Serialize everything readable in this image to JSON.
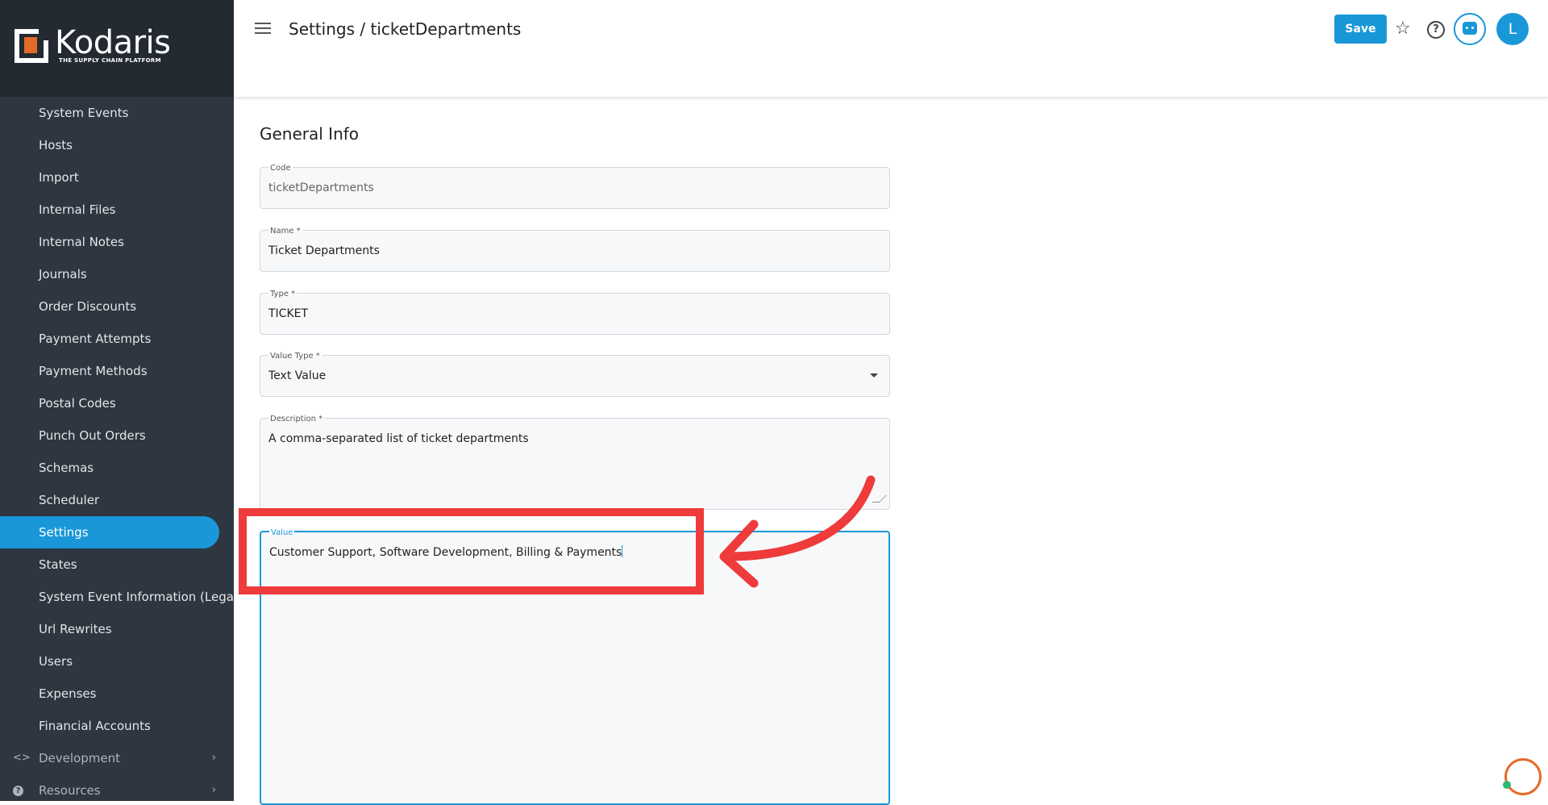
{
  "brand": {
    "name": "Kodaris",
    "tagline": "THE SUPPLY CHAIN PLATFORM"
  },
  "sidebar": {
    "items": [
      {
        "label": "System Events"
      },
      {
        "label": "Hosts"
      },
      {
        "label": "Import"
      },
      {
        "label": "Internal Files"
      },
      {
        "label": "Internal Notes"
      },
      {
        "label": "Journals"
      },
      {
        "label": "Order Discounts"
      },
      {
        "label": "Payment Attempts"
      },
      {
        "label": "Payment Methods"
      },
      {
        "label": "Postal Codes"
      },
      {
        "label": "Punch Out Orders"
      },
      {
        "label": "Schemas"
      },
      {
        "label": "Scheduler"
      },
      {
        "label": "Settings",
        "active": true
      },
      {
        "label": "States"
      },
      {
        "label": "System Event Information (Legacy)"
      },
      {
        "label": "Url Rewrites"
      },
      {
        "label": "Users"
      },
      {
        "label": "Expenses"
      },
      {
        "label": "Financial Accounts"
      }
    ],
    "groups": [
      {
        "label": "Development",
        "icon": "code-icon"
      },
      {
        "label": "Resources",
        "icon": "help-icon"
      }
    ]
  },
  "header": {
    "title": "Settings / ticketDepartments",
    "save_label": "Save",
    "avatar_initial": "L"
  },
  "form": {
    "section_title": "General Info",
    "code": {
      "label": "Code",
      "value": "ticketDepartments"
    },
    "name": {
      "label": "Name *",
      "value": "Ticket Departments"
    },
    "type": {
      "label": "Type *",
      "value": "TICKET"
    },
    "value_type": {
      "label": "Value Type *",
      "value": "Text Value"
    },
    "description": {
      "label": "Description *",
      "value": "A comma-separated list of ticket departments"
    },
    "value": {
      "label": "Value",
      "value": "Customer Support, Software Development, Billing & Payments"
    }
  },
  "colors": {
    "accent": "#1a97d8",
    "sidebar_bg": "#2e3640",
    "annotation": "#ef3b3b"
  }
}
